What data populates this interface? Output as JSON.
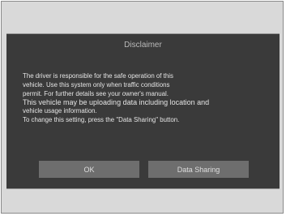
{
  "dialog": {
    "title": "Disclaimer",
    "lines": [
      "The driver is responsible for the safe operation of this",
      "vehicle. Use this system only when traffic conditions",
      "permit. For further details see your owner's manual.",
      "This vehicle may be uploading data including location and",
      "vehicle usage information.",
      "To change this setting, press the \"Data Sharing\" button."
    ],
    "ok_label": "OK",
    "data_sharing_label": "Data Sharing"
  }
}
